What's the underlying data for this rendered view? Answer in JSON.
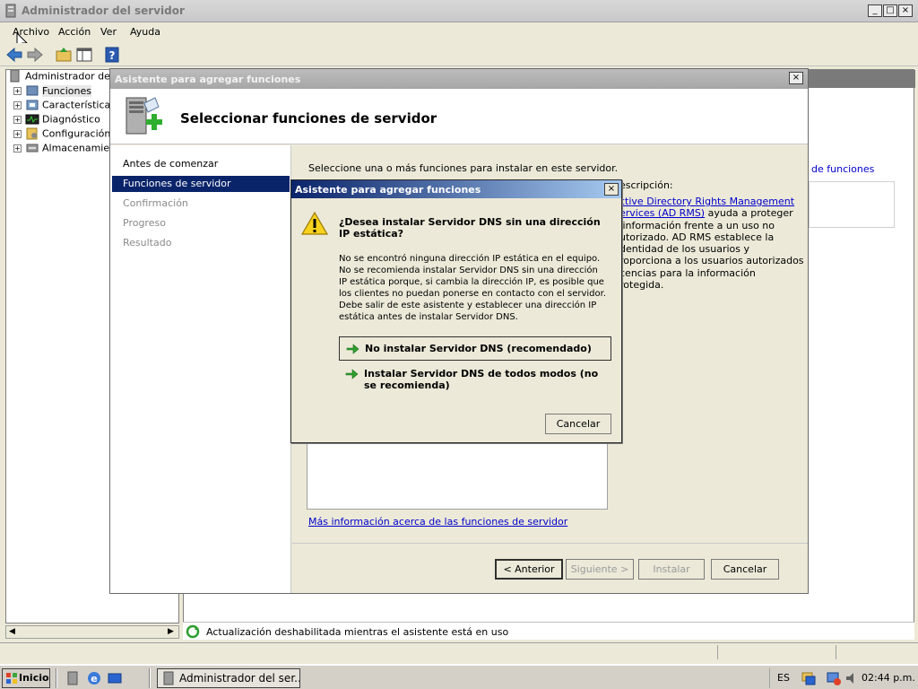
{
  "main_window": {
    "title": "Administrador del servidor",
    "controls": {
      "minimize": "_",
      "maximize": "□",
      "close": "×"
    },
    "menu": [
      "Archivo",
      "Acción",
      "Ver",
      "Ayuda"
    ]
  },
  "tree": {
    "root": "Administrador del se",
    "items": [
      {
        "label": "Funciones",
        "icon": "roles-icon"
      },
      {
        "label": "Características",
        "icon": "features-icon"
      },
      {
        "label": "Diagnóstico",
        "icon": "diagnostics-icon"
      },
      {
        "label": "Configuración",
        "icon": "configuration-icon"
      },
      {
        "label": "Almacenamiento",
        "icon": "storage-icon"
      }
    ]
  },
  "right_pane": {
    "link": "de funciones",
    "status": "Actualización deshabilitada mientras el asistente está en uso"
  },
  "wizard": {
    "title": "Asistente para agregar funciones",
    "close": "×",
    "heading": "Seleccionar funciones de servidor",
    "nav": [
      {
        "label": "Antes de comenzar",
        "state": "normal"
      },
      {
        "label": "Funciones de servidor",
        "state": "active"
      },
      {
        "label": "Confirmación",
        "state": "disabled"
      },
      {
        "label": "Progreso",
        "state": "disabled"
      },
      {
        "label": "Resultado",
        "state": "disabled"
      }
    ],
    "instruction": "Seleccione una o más funciones para instalar en este servidor.",
    "description_title": "escripción:",
    "description_link": "ctive Directory Rights Management\nervices (AD RMS)",
    "description_text": " ayuda a proteger\n información frente a un uso no\nutorizado. AD RMS establece la\ndentidad de los usuarios y\nroporciona a los usuarios autorizados\ncencias para la información\nrotegida.",
    "more_info": "Más información acerca de las funciones de servidor",
    "buttons": {
      "previous": "< Anterior",
      "next": "Siguiente >",
      "install": "Instalar",
      "cancel": "Cancelar"
    }
  },
  "dialog": {
    "title": "Asistente para agregar funciones",
    "close": "×",
    "question": "¿Desea instalar Servidor DNS sin una dirección IP estática?",
    "message": "No se encontró ninguna dirección IP estática en el equipo. No se recomienda instalar Servidor DNS sin una dirección IP estática porque, si cambia la dirección IP, es posible que los clientes no puedan ponerse en contacto con el servidor. Debe salir de este asistente y establecer una dirección IP estática antes de instalar Servidor DNS.",
    "option_1": "No instalar Servidor DNS (recomendado)",
    "option_2": "Instalar Servidor DNS de todos modos (no se recomienda)",
    "cancel": "Cancelar"
  },
  "taskbar": {
    "start": "Inicio",
    "task": "Administrador del ser...",
    "language": "ES",
    "clock": "02:44 p.m."
  },
  "colors": {
    "selection": "#0a246a",
    "link": "#0000cc",
    "dialog_title_start": "#0a246a",
    "dialog_title_end": "#a6caf0",
    "green_arrow": "#2e9e2e"
  }
}
